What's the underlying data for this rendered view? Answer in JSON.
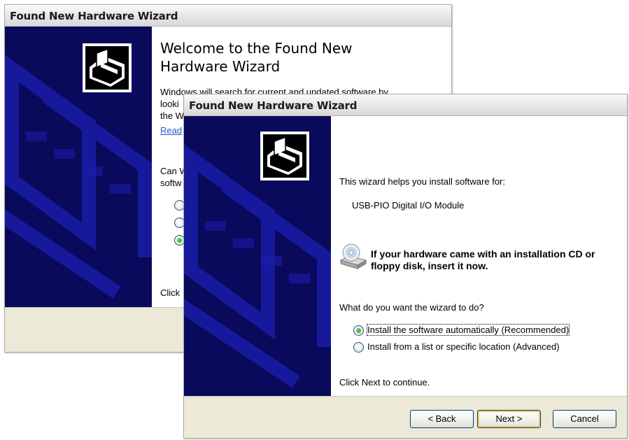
{
  "back_window": {
    "title": "Found New Hardware Wizard",
    "heading_line1": "Welcome to the Found New",
    "heading_line2": "Hardware Wizard",
    "partial_text_1": "Windows will search for current and updated software by",
    "partial_text_2": "looki",
    "partial_text_3": "the W",
    "partial_link": "Read",
    "partial_text_4": "Can W",
    "partial_text_5": "softw",
    "partial_text_6": "Click"
  },
  "front_window": {
    "title": "Found New Hardware Wizard",
    "intro": "This wizard helps you install software for:",
    "device_name": "USB-PIO Digital I/O Module",
    "cd_notice": "If your hardware came with an installation CD or floppy disk, insert it now.",
    "question": "What do you want the wizard to do?",
    "options": [
      {
        "label": "Install the software automatically (Recommended)",
        "checked": true
      },
      {
        "label": "Install from a list or specific location (Advanced)",
        "checked": false
      }
    ],
    "continue_text": "Click Next to continue.",
    "buttons": {
      "back": "< Back",
      "next": "Next >",
      "cancel": "Cancel"
    }
  },
  "colors": {
    "side_panel": "#0a0a5c",
    "side_pattern": "#1a1ca8",
    "radio_checked": "#21a121",
    "link": "#2a56c8"
  },
  "icons": {
    "wizard": "hardware-install-icon",
    "cd": "cd-drive-icon"
  }
}
